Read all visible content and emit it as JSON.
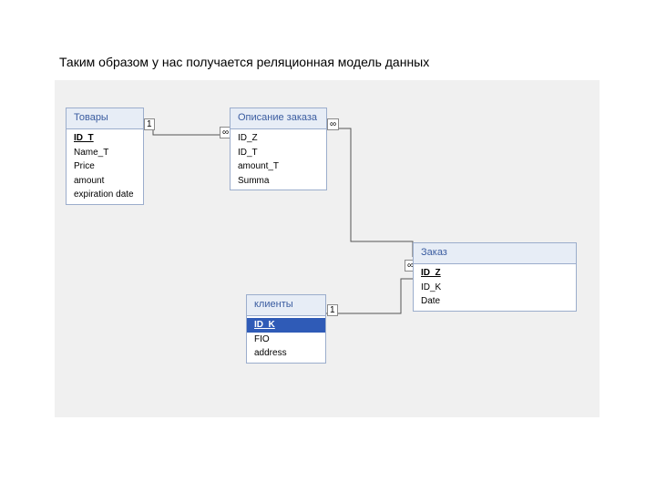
{
  "heading": "Таким образом у нас получается реляционная модель данных",
  "entities": {
    "goods": {
      "title": "Товары",
      "fields": [
        "ID_T",
        "Name_T",
        "Price",
        "amount",
        "expiration date"
      ],
      "pk_index": 0
    },
    "order_desc": {
      "title": "Описание заказа",
      "fields": [
        "ID_Z",
        "ID_T",
        "amount_T",
        "Summa"
      ]
    },
    "clients": {
      "title": "клиенты",
      "fields": [
        "ID_K",
        "FIO",
        "address"
      ],
      "pk_index": 0,
      "selected_index": 0
    },
    "order": {
      "title": "Заказ",
      "fields": [
        "ID_Z",
        "ID_K",
        "Date"
      ],
      "pk_index": 0
    }
  },
  "cardinality": {
    "one": "1",
    "many": "∞"
  }
}
